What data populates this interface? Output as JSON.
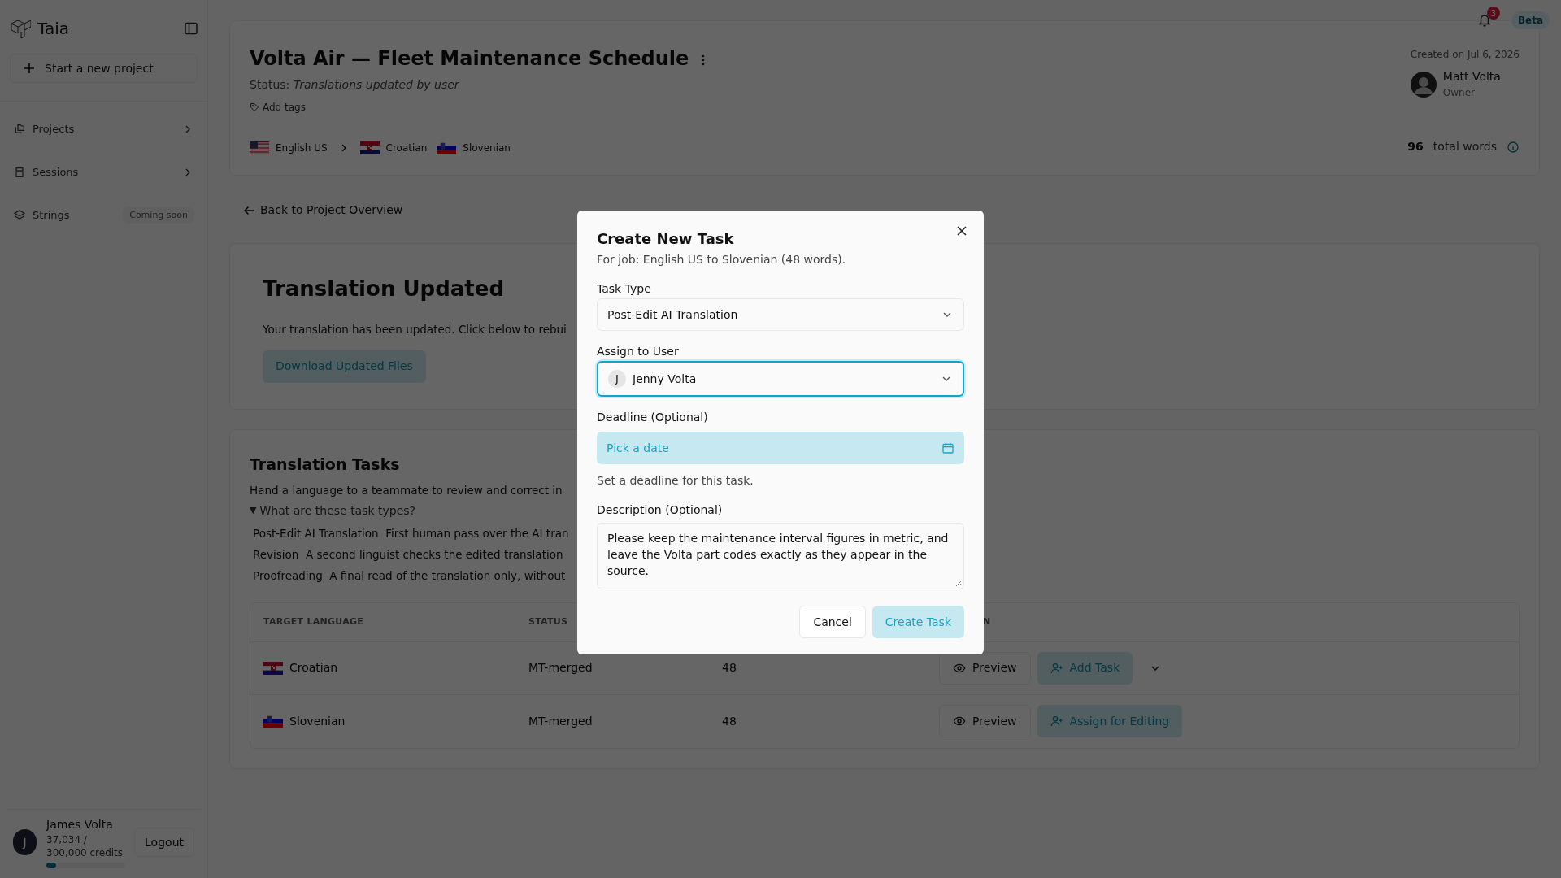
{
  "sidebar": {
    "brand": "Taia",
    "new_project": "Start a new project",
    "items": [
      {
        "label": "Projects",
        "kind": "expandable"
      },
      {
        "label": "Sessions",
        "kind": "expandable"
      },
      {
        "label": "Strings",
        "kind": "badge",
        "badge": "Coming soon"
      }
    ],
    "user": {
      "initial": "J",
      "name": "James Volta",
      "credits": "37,034 / 300,000 credits",
      "level": 0.123
    },
    "logout": "Logout"
  },
  "topbar": {
    "notification_count": "3",
    "badge": "Beta"
  },
  "project": {
    "title": "Volta Air — Fleet Maintenance Schedule",
    "status_label": "Status:",
    "status": "Translations updated by user",
    "add_tags": "Add tags",
    "source_language": {
      "name": "English US",
      "kind": "us"
    },
    "target_languages": [
      {
        "name": "Croatian",
        "kind": "hr"
      },
      {
        "name": "Slovenian",
        "kind": "si"
      }
    ],
    "created": "Created on Jul 6, 2026",
    "owner": {
      "name": "Matt Volta",
      "role": "Owner"
    },
    "word_count": "96",
    "word_count_label": "total words"
  },
  "back_link": "Back to Project Overview",
  "update_card": {
    "title": "Translation Updated",
    "text": "Your translation has been updated. Click below to rebui",
    "button": "Download Updated Files"
  },
  "tasks": {
    "title": "Translation Tasks",
    "intro": "Hand a language to a teammate to review and correct in",
    "help_toggle": "▼",
    "help_title": "What are these task types?",
    "help_items": [
      {
        "term": "Post-Edit AI Translation",
        "desc": "First human pass over the AI tran"
      },
      {
        "term": "Revision",
        "desc": "A second linguist checks the edited translation"
      },
      {
        "term": "Proofreading",
        "desc": "A final read of the translation only, without"
      }
    ],
    "columns": [
      "TARGET LANGUAGE",
      "STATUS",
      "",
      "N"
    ],
    "rows": [
      {
        "language": "Croatian",
        "kind": "hr",
        "status": "MT-merged",
        "words": "48",
        "actions": [
          {
            "kind": "preview",
            "label": "Preview"
          },
          {
            "kind": "assign",
            "label": "Add Task"
          },
          {
            "kind": "menu"
          }
        ]
      },
      {
        "language": "Slovenian",
        "kind": "si",
        "status": "MT-merged",
        "words": "48",
        "actions": [
          {
            "kind": "preview",
            "label": "Preview"
          },
          {
            "kind": "assign",
            "label": "Assign for Editing"
          }
        ]
      }
    ]
  },
  "dialog": {
    "title": "Create New Task",
    "subtitle": "For job: English US to Slovenian (48 words).",
    "fields": [
      {
        "kind": "select",
        "label": "Task Type",
        "value": "Post-Edit AI Translation",
        "focused": false
      },
      {
        "kind": "user",
        "label": "Assign to User",
        "initial": "J",
        "value": "Jenny Volta",
        "focused": true
      },
      {
        "kind": "date",
        "label": "Deadline (Optional)",
        "placeholder": "Pick a date",
        "hint": "Set a deadline for this task."
      },
      {
        "kind": "textarea",
        "label": "Description (Optional)",
        "value": "Please keep the maintenance interval figures in metric, and leave the Volta part codes exactly as they appear in the source."
      }
    ],
    "cancel": "Cancel",
    "submit": "Create Task"
  }
}
